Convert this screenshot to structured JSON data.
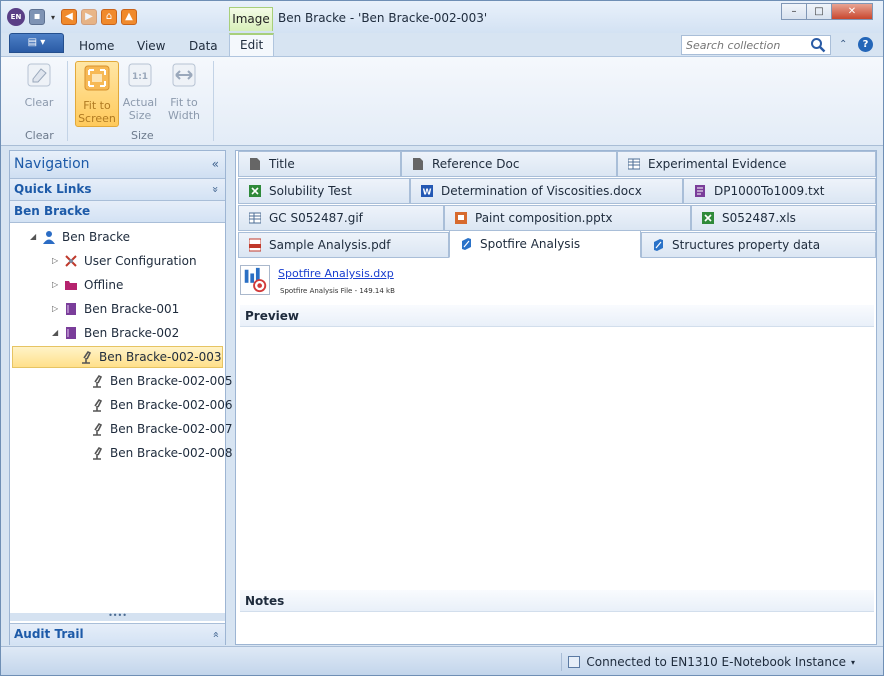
{
  "window": {
    "title": "Ben Bracke - 'Ben Bracke-002-003'",
    "context_tab_group": "Image",
    "controls": {
      "minimize": "–",
      "maximize": "□",
      "close": "✕"
    }
  },
  "qat": {
    "logo": "EN",
    "separator": "▾"
  },
  "ribbon": {
    "file_button": "▤ ▾",
    "tabs": [
      "Home",
      "View",
      "Data",
      "Edit"
    ],
    "active_tab": "Edit",
    "search": {
      "placeholder": "Search collection"
    },
    "collapse": "⌃",
    "help": "?",
    "buttons": {
      "clear": "Clear",
      "fit_to_screen": "Fit to Screen",
      "actual_size": "Actual Size",
      "fit_to_width": "Fit to Width"
    },
    "groups": {
      "clear": "Clear",
      "size": "Size"
    }
  },
  "navigation": {
    "title": "Navigation",
    "collapse_glyph": "«",
    "quick_links": "Quick Links",
    "section_glyph": "»",
    "current_section": "Ben Bracke",
    "splitter": "••••",
    "audit_trail": "Audit Trail",
    "audit_glyph": "»",
    "tree": [
      {
        "label": "Ben Bracke",
        "expander": "◢",
        "icon": "user-icon"
      },
      {
        "label": "User Configuration",
        "expander": "▷",
        "icon": "tools-icon"
      },
      {
        "label": "Offline",
        "expander": "▷",
        "icon": "folder-icon"
      },
      {
        "label": "Ben Bracke-001",
        "expander": "▷",
        "icon": "notebook-icon"
      },
      {
        "label": "Ben Bracke-002",
        "expander": "◢",
        "icon": "notebook-icon"
      },
      {
        "label": "Ben Bracke-002-003",
        "expander": "",
        "icon": "experiment-icon",
        "selected": true
      },
      {
        "label": "Ben Bracke-002-005",
        "expander": "",
        "icon": "experiment-icon"
      },
      {
        "label": "Ben Bracke-002-006",
        "expander": "",
        "icon": "experiment-icon"
      },
      {
        "label": "Ben Bracke-002-007",
        "expander": "",
        "icon": "experiment-icon"
      },
      {
        "label": "Ben Bracke-002-008",
        "expander": "",
        "icon": "experiment-icon"
      }
    ]
  },
  "document_tabs": {
    "row1": [
      "Title",
      "Reference Doc",
      "Experimental Evidence"
    ],
    "row2": [
      "Solubility Test",
      "Determination of Viscosities.docx",
      "DP1000To1009.txt"
    ],
    "row3": [
      "GC S052487.gif",
      "Paint composition.pptx",
      "S052487.xls"
    ],
    "row4": [
      "Sample Analysis.pdf",
      "Spotfire Analysis",
      "Structures property data"
    ],
    "active": "Spotfire Analysis"
  },
  "attachment": {
    "name": "Spotfire Analysis.dxp",
    "meta": "Spotfire Analysis File - 149.14 kB"
  },
  "sections": {
    "preview": "Preview",
    "notes": "Notes"
  },
  "status": {
    "connection": "Connected to EN1310 E-Notebook Instance",
    "dropdown": "▾"
  },
  "colors": {
    "accent": "#1d5aa8",
    "selected": "#ffe08a",
    "context": "#a8cf7a"
  }
}
